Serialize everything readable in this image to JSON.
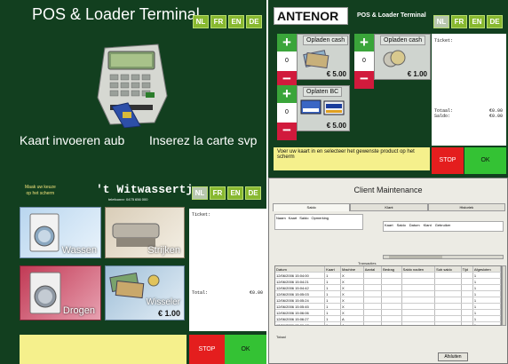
{
  "languages": [
    "NL",
    "FR",
    "EN",
    "DE"
  ],
  "q1": {
    "title": "POS & Loader Terminal",
    "prompt_nl": "Kaart invoeren aub",
    "prompt_fr": "Inserez la carte svp"
  },
  "q2": {
    "logo": "ANTENOR",
    "title": "POS & Loader Terminal",
    "products": [
      {
        "label": "Opladen cash",
        "qty": "0",
        "price": "€ 5.00"
      },
      {
        "label": "Opladen cash",
        "qty": "0",
        "price": "€ 1.00"
      },
      {
        "label": "Oplaten BC",
        "qty": "0",
        "price": "€ 5.00"
      }
    ],
    "ticket_label": "Ticket:",
    "sub1_label": "Totaal:",
    "sub1_value": "€0.00",
    "sub2_label": "Saldo:",
    "sub2_value": "€0.00",
    "message": "Voer uw kaart in en selecteer het gewenste product op het scherm",
    "stop": "STOP",
    "ok": "OK"
  },
  "q3": {
    "choose_line1": "Maak uw keuze",
    "choose_line2": "op het scherm",
    "brand": "'t Witwassertje",
    "phone": "telefoonnr: 0475 656 000",
    "tiles": [
      {
        "label": "Wassen",
        "price": ""
      },
      {
        "label": "Strijken",
        "price": ""
      },
      {
        "label": "Drogen",
        "price": ""
      },
      {
        "label": "Wisseler",
        "price": "€ 1.00"
      }
    ],
    "ticket_label": "Ticket:",
    "total_label": "Total:",
    "total_value": "€0.00",
    "stop": "STOP",
    "ok": "OK"
  },
  "q4": {
    "title": "Client Maintenance",
    "tabs": [
      "Saldo",
      "Klant",
      "Historiek"
    ],
    "fields": [
      "Naam",
      "Kaart",
      "Saldo",
      "Opmerking"
    ],
    "sub_headers": [
      "Kaart",
      "Saldo",
      "Datum",
      "Klant",
      "Gebruiker"
    ],
    "table_title": "Transacties",
    "columns": [
      "Datum",
      "Kaart",
      "Machine",
      "Aantal",
      "Bedrag",
      "Saldo nadien",
      "Sub saldo",
      "Tijd",
      "Afgesloten"
    ],
    "rows": [
      [
        "12/06/2006 15:04:00",
        "1",
        "X",
        "",
        "",
        "",
        "",
        "",
        "1"
      ],
      [
        "12/06/2006 15:04:21",
        "1",
        "X",
        "",
        "",
        "",
        "",
        "",
        "1"
      ],
      [
        "12/06/2006 15:04:42",
        "1",
        "X",
        "",
        "",
        "",
        "",
        "",
        "1"
      ],
      [
        "12/06/2006 15:05:03",
        "1",
        "X",
        "",
        "",
        "",
        "",
        "",
        "1"
      ],
      [
        "12/06/2006 15:05:24",
        "1",
        "X",
        "",
        "",
        "",
        "",
        "",
        "1"
      ],
      [
        "12/06/2006 15:05:45",
        "1",
        "X",
        "",
        "",
        "",
        "",
        "",
        "1"
      ],
      [
        "12/06/2006 15:06:06",
        "1",
        "X",
        "",
        "",
        "",
        "",
        "",
        "1"
      ],
      [
        "12/06/2006 15:06:27",
        "1",
        "A",
        "",
        "",
        "",
        "",
        "",
        "1"
      ],
      [
        "12/06/2006 15:06:48",
        "1",
        "A",
        "",
        "",
        "",
        "",
        "",
        "1"
      ],
      [
        "12/06/2006 15:07:09",
        "1",
        "A",
        "",
        "",
        "",
        "",
        "",
        "1"
      ],
      [
        "12/06/2006 15:07:30",
        "1",
        "A",
        "",
        "",
        "",
        "",
        "",
        "1"
      ],
      [
        "12/06/2006 15:07:51",
        "1",
        "A",
        "",
        "",
        "",
        "",
        "",
        "1"
      ]
    ],
    "footer_label": "Totaal",
    "button": "Afsluiten"
  },
  "colors": {
    "dark_green": "#123f1f",
    "lang_green": "#88b830",
    "stop_red": "#e41e1e",
    "ok_green": "#34c234",
    "msg_yellow": "#f5f08c"
  }
}
